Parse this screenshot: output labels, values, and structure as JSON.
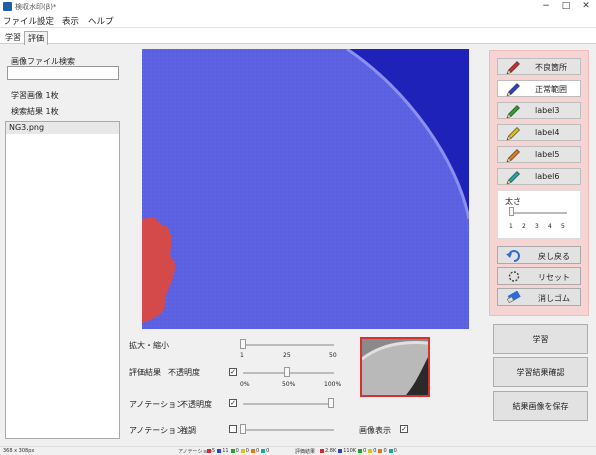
{
  "window": {
    "title": "検収水印(β)*"
  },
  "menu": [
    "ファイル",
    "設定",
    "表示",
    "ヘルプ"
  ],
  "tabs": [
    "学習",
    "評価"
  ],
  "left": {
    "search_label": "画像ファイル検索",
    "search_value": "",
    "train_count": "学習画像 1枚",
    "result_count": "検索結果 1枚",
    "files": [
      "NG3.png"
    ]
  },
  "tools": {
    "pens": [
      {
        "label": "不良箇所",
        "color": "#d12b2b"
      },
      {
        "label": "正常範囲",
        "color": "#2a44c8"
      },
      {
        "label": "label3",
        "color": "#2aa02a"
      },
      {
        "label": "label4",
        "color": "#d8c21a"
      },
      {
        "label": "label5",
        "color": "#e07a1a"
      },
      {
        "label": "label6",
        "color": "#1aa8a0"
      }
    ],
    "active_pen": 1,
    "brush_label": "太さ",
    "brush_ticks": [
      "1",
      "2",
      "3",
      "4",
      "5"
    ],
    "brush_value": 1,
    "undo": "戻し戻る",
    "reset": "リセット",
    "eraser": "消しゴム"
  },
  "controls": {
    "zoom_label": "拡大・縮小",
    "zoom_ticks": [
      "1",
      "25",
      "50"
    ],
    "zoom_value": 1,
    "eval_label": "評価結果",
    "eval_opacity_label": "不透明度",
    "eval_checked": true,
    "eval_ticks": [
      "0%",
      "50%",
      "100%"
    ],
    "eval_opacity_value": 0.5,
    "anno_label": "アノテーション",
    "anno_opacity_label": "不透明度",
    "anno_checked": true,
    "anno_opacity_value": 1.0,
    "anno2_label": "アノテーション",
    "anno2_sub_label": "強調",
    "anno2_checked": false,
    "anno2_value": 0,
    "show_image_label": "画像表示",
    "show_image_checked": true
  },
  "actions": {
    "learn": "学習",
    "check": "学習結果確認",
    "save": "結果画像を保存"
  },
  "status": {
    "size": "368 x 308px",
    "anno_label": "アノテーション",
    "anno_items": [
      "5",
      "11",
      "0",
      "0",
      "0",
      "0"
    ],
    "eval_label": "評価結果",
    "eval_items": [
      "2.8K",
      "110K",
      "0",
      "0",
      "0",
      "0"
    ],
    "colors": [
      "#d12b2b",
      "#2a44c8",
      "#2aa02a",
      "#d8c21a",
      "#e07a1a",
      "#1aa8a0"
    ]
  }
}
